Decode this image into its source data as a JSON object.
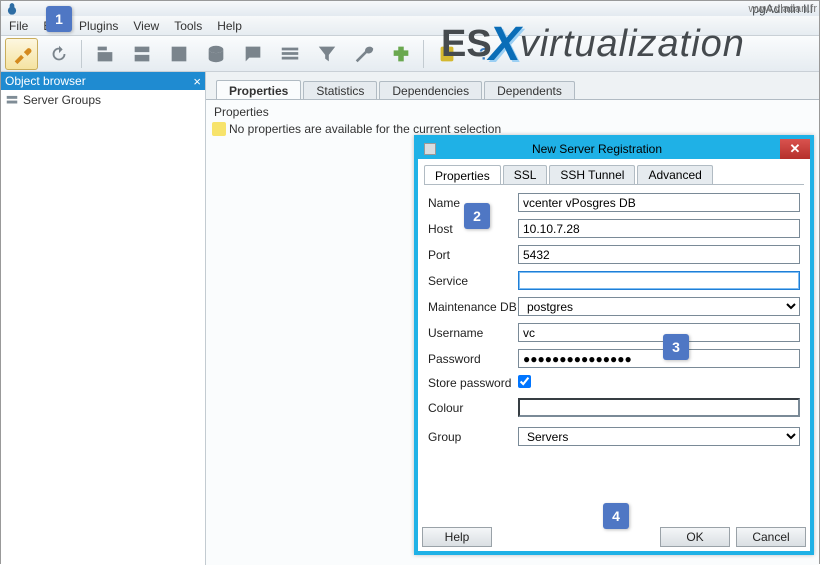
{
  "app": {
    "title": "pgAdmin III"
  },
  "watermark": "www.vladan.fr",
  "banner": {
    "es": "ES",
    "x": "X",
    "rest": "virtualization"
  },
  "menu": [
    "File",
    "Edit",
    "Plugins",
    "View",
    "Tools",
    "Help"
  ],
  "sidebar": {
    "title": "Object browser",
    "node": "Server Groups"
  },
  "tabs": [
    "Properties",
    "Statistics",
    "Dependencies",
    "Dependents"
  ],
  "details": {
    "heading": "Properties",
    "emptyMsg": "No properties are available for the current selection"
  },
  "dialog": {
    "title": "New Server Registration",
    "tabs": [
      "Properties",
      "SSL",
      "SSH Tunnel",
      "Advanced"
    ],
    "labels": {
      "name": "Name",
      "host": "Host",
      "port": "Port",
      "service": "Service",
      "mdb": "Maintenance DB",
      "user": "Username",
      "pass": "Password",
      "store": "Store password",
      "colour": "Colour",
      "group": "Group"
    },
    "values": {
      "name": "vcenter vPosgres DB",
      "host": "10.10.7.28",
      "port": "5432",
      "service": "",
      "mdb": "postgres",
      "user": "vc",
      "pass": "●●●●●●●●●●●●●●●",
      "store": true,
      "group": "Servers"
    },
    "buttons": {
      "help": "Help",
      "ok": "OK",
      "cancel": "Cancel"
    }
  },
  "callouts": {
    "c1": "1",
    "c2": "2",
    "c3": "3",
    "c4": "4"
  }
}
